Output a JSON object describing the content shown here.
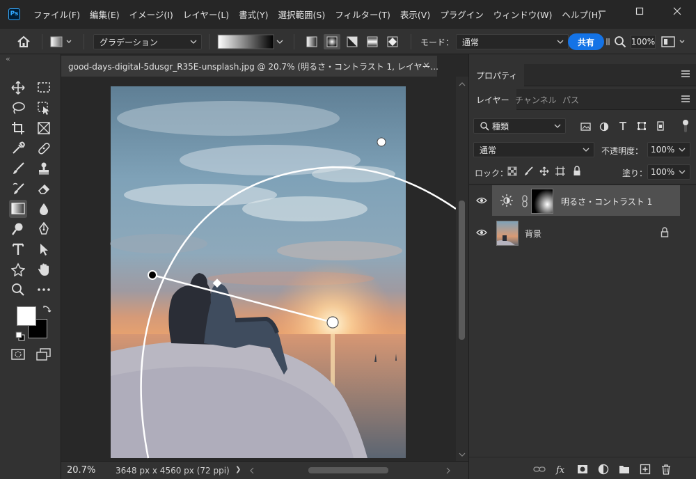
{
  "app": {
    "logo_text": "Ps",
    "menu": [
      "ファイル(F)",
      "編集(E)",
      "イメージ(I)",
      "レイヤー(L)",
      "書式(Y)",
      "選択範囲(S)",
      "フィルター(T)",
      "表示(V)",
      "プラグイン",
      "ウィンドウ(W)",
      "ヘルプ(H)"
    ]
  },
  "options_bar": {
    "preset_label": "グラデーション",
    "mode_label": "モード：",
    "mode_value": "通常",
    "share_label": "共有",
    "zoom_value": "100%"
  },
  "document": {
    "tab_title": "good-days-digital-5dusgr_R35E-unsplash.jpg @ 20.7% (明るさ・コントラスト 1, レイヤー...",
    "close_glyph": "×",
    "zoom": "20.7%",
    "size_info": "3648 px x 4560 px (72 ppi)",
    "next_arrow": "❯"
  },
  "panels": {
    "collapse_glyph": "«",
    "properties_tab": "プロパティ",
    "tabs": [
      "レイヤー",
      "チャンネル",
      "パス"
    ],
    "filter_kind": "種類",
    "blend_mode": "通常",
    "opacity_label": "不透明度：",
    "opacity_value": "100%",
    "lock_label": "ロック：",
    "fill_label": "塗り：",
    "fill_value": "100%",
    "layers": [
      {
        "name": "明るさ・コントラスト 1",
        "selected": true
      },
      {
        "name": "背景",
        "selected": false
      }
    ]
  },
  "colors": {
    "accent": "#1473e6",
    "panel_bg": "#323232",
    "canvas_bg": "#282828"
  }
}
